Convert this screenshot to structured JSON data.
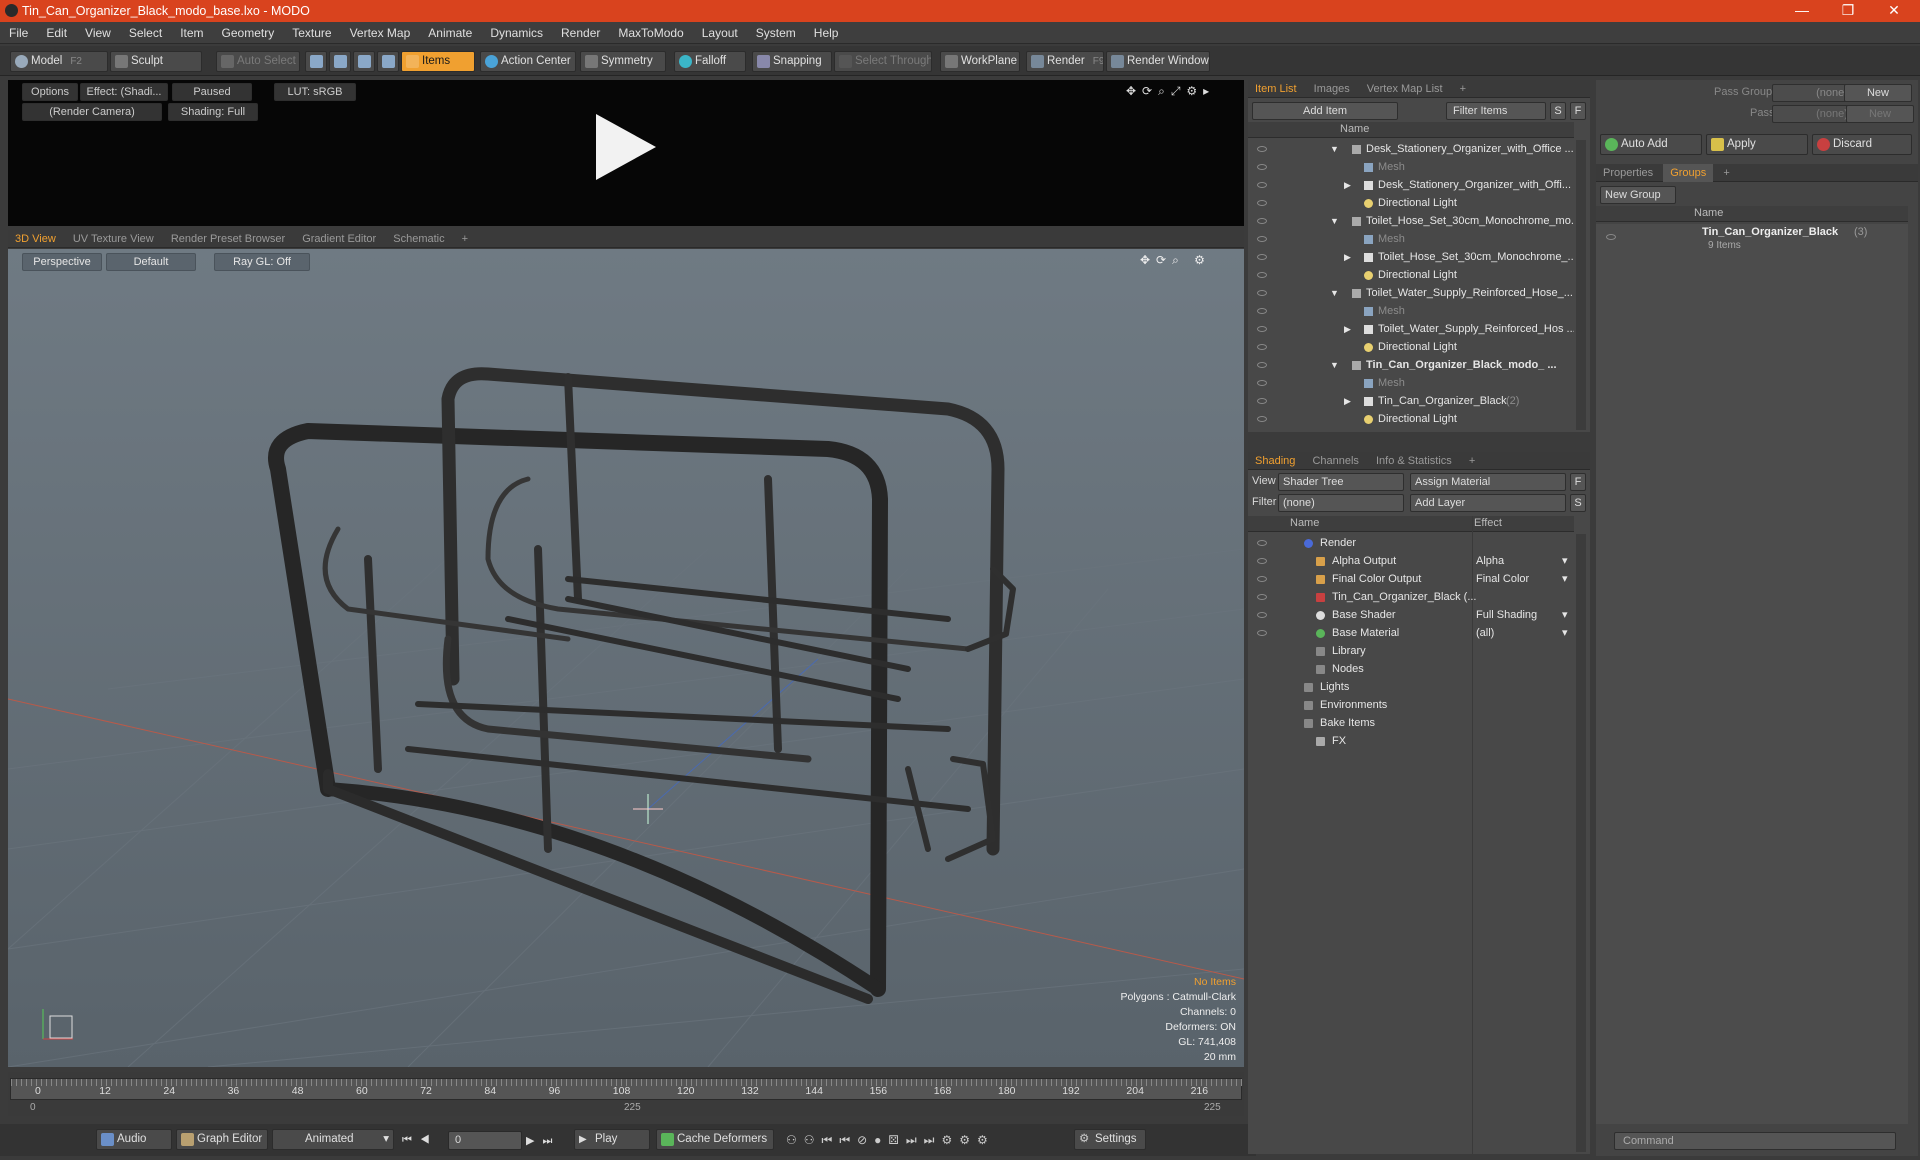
{
  "window": {
    "title": "Tin_Can_Organizer_Black_modo_base.lxo - MODO",
    "min": "—",
    "max": "❐",
    "close": "✕"
  },
  "menu": [
    "File",
    "Edit",
    "View",
    "Select",
    "Item",
    "Geometry",
    "Texture",
    "Vertex Map",
    "Animate",
    "Dynamics",
    "Render",
    "MaxToModo",
    "Layout",
    "System",
    "Help"
  ],
  "toolbar": {
    "model": "Model",
    "model_key": "F2",
    "sculpt": "Sculpt",
    "auto_select": "Auto Select",
    "items": "Items",
    "action_center": "Action Center",
    "symmetry": "Symmetry",
    "falloff": "Falloff",
    "snapping": "Snapping",
    "select_through": "Select Through",
    "workplane": "WorkPlane",
    "render": "Render",
    "render_key": "F9",
    "render_window": "Render Window"
  },
  "preview": {
    "options": "Options",
    "effect": "Effect: (Shadi...",
    "paused": "Paused",
    "lut": "LUT: sRGB",
    "camera": "(Render Camera)",
    "shading": "Shading: Full"
  },
  "viewport_tabs": [
    "3D View",
    "UV Texture View",
    "Render Preset Browser",
    "Gradient Editor",
    "Schematic"
  ],
  "viewport": {
    "perspective": "Perspective",
    "default": "Default",
    "raygl": "Ray GL: Off"
  },
  "stats": {
    "no_items": "No Items",
    "polygons": "Polygons : Catmull-Clark",
    "channels": "Channels: 0",
    "deformers": "Deformers: ON",
    "gl": "GL: 741,408",
    "scale": "20 mm"
  },
  "timeline": {
    "ticks": [
      "0",
      "12",
      "24",
      "36",
      "48",
      "60",
      "72",
      "84",
      "96",
      "108",
      "120",
      "132",
      "144",
      "156",
      "168",
      "180",
      "192",
      "204",
      "216"
    ],
    "start": "0",
    "mid": "225",
    "end": "225"
  },
  "bottombar": {
    "audio": "Audio",
    "graph_editor": "Graph Editor",
    "animated": "Animated",
    "frame": "0",
    "play": "Play",
    "cache": "Cache Deformers",
    "settings": "Settings"
  },
  "item_list": {
    "tabs": [
      "Item List",
      "Images",
      "Vertex Map List"
    ],
    "add_item": "Add Item",
    "filter": "Filter Items",
    "s": "S",
    "f": "F",
    "name_col": "Name",
    "rows": [
      {
        "label": "Desk_Stationery_Organizer_with_Office ...",
        "type": "scene"
      },
      {
        "label": "Mesh",
        "type": "mesh"
      },
      {
        "label": "Desk_Stationery_Organizer_with_Offi...",
        "type": "group"
      },
      {
        "label": "Directional Light",
        "type": "light"
      },
      {
        "label": "Toilet_Hose_Set_30cm_Monochrome_mo...",
        "type": "scene"
      },
      {
        "label": "Mesh",
        "type": "mesh"
      },
      {
        "label": "Toilet_Hose_Set_30cm_Monochrome_...",
        "type": "group"
      },
      {
        "label": "Directional Light",
        "type": "light"
      },
      {
        "label": "Toilet_Water_Supply_Reinforced_Hose_...",
        "type": "scene"
      },
      {
        "label": "Mesh",
        "type": "mesh"
      },
      {
        "label": "Toilet_Water_Supply_Reinforced_Hos ...",
        "type": "group"
      },
      {
        "label": "Directional Light",
        "type": "light"
      },
      {
        "label": "Tin_Can_Organizer_Black_modo_ ...",
        "type": "scene-bold"
      },
      {
        "label": "Mesh",
        "type": "mesh"
      },
      {
        "label": "Tin_Can_Organizer_Black",
        "type": "group",
        "suffix": "(2)"
      },
      {
        "label": "Directional Light",
        "type": "light"
      }
    ]
  },
  "shading": {
    "tabs": [
      "Shading",
      "Channels",
      "Info & Statistics"
    ],
    "view_label": "View",
    "view_value": "Shader Tree",
    "assign": "Assign Material",
    "f": "F",
    "filter_label": "Filter",
    "filter_value": "(none)",
    "add_layer": "Add Layer",
    "s": "S",
    "cols": {
      "name": "Name",
      "effect": "Effect"
    },
    "rows": [
      {
        "name": "Render",
        "effect": "",
        "indent": 0
      },
      {
        "name": "Alpha Output",
        "effect": "Alpha",
        "indent": 1
      },
      {
        "name": "Final Color Output",
        "effect": "Final Color",
        "indent": 1
      },
      {
        "name": "Tin_Can_Organizer_Black (...",
        "effect": "",
        "indent": 1
      },
      {
        "name": "Base Shader",
        "effect": "Full Shading",
        "indent": 1
      },
      {
        "name": "Base Material",
        "effect": "(all)",
        "indent": 1
      },
      {
        "name": "Library",
        "effect": "",
        "indent": 1
      },
      {
        "name": "Nodes",
        "effect": "",
        "indent": 1
      },
      {
        "name": "Lights",
        "effect": "",
        "indent": 0
      },
      {
        "name": "Environments",
        "effect": "",
        "indent": 0
      },
      {
        "name": "Bake Items",
        "effect": "",
        "indent": 0
      },
      {
        "name": "FX",
        "effect": "",
        "indent": 1
      }
    ]
  },
  "right_panel": {
    "pass_groups": "Pass Groups",
    "passes": "Passes",
    "none": "(none)",
    "new": "New",
    "auto_add": "Auto Add",
    "apply": "Apply",
    "discard": "Discard",
    "tabs": [
      "Properties",
      "Groups"
    ],
    "new_group": "New Group",
    "name_col": "Name",
    "group_name": "Tin_Can_Organizer_Black",
    "group_count": "(3)",
    "group_items": "9 Items",
    "command": "Command"
  },
  "colors": {
    "accent": "#f0a030",
    "titlebar": "#d9431e"
  }
}
